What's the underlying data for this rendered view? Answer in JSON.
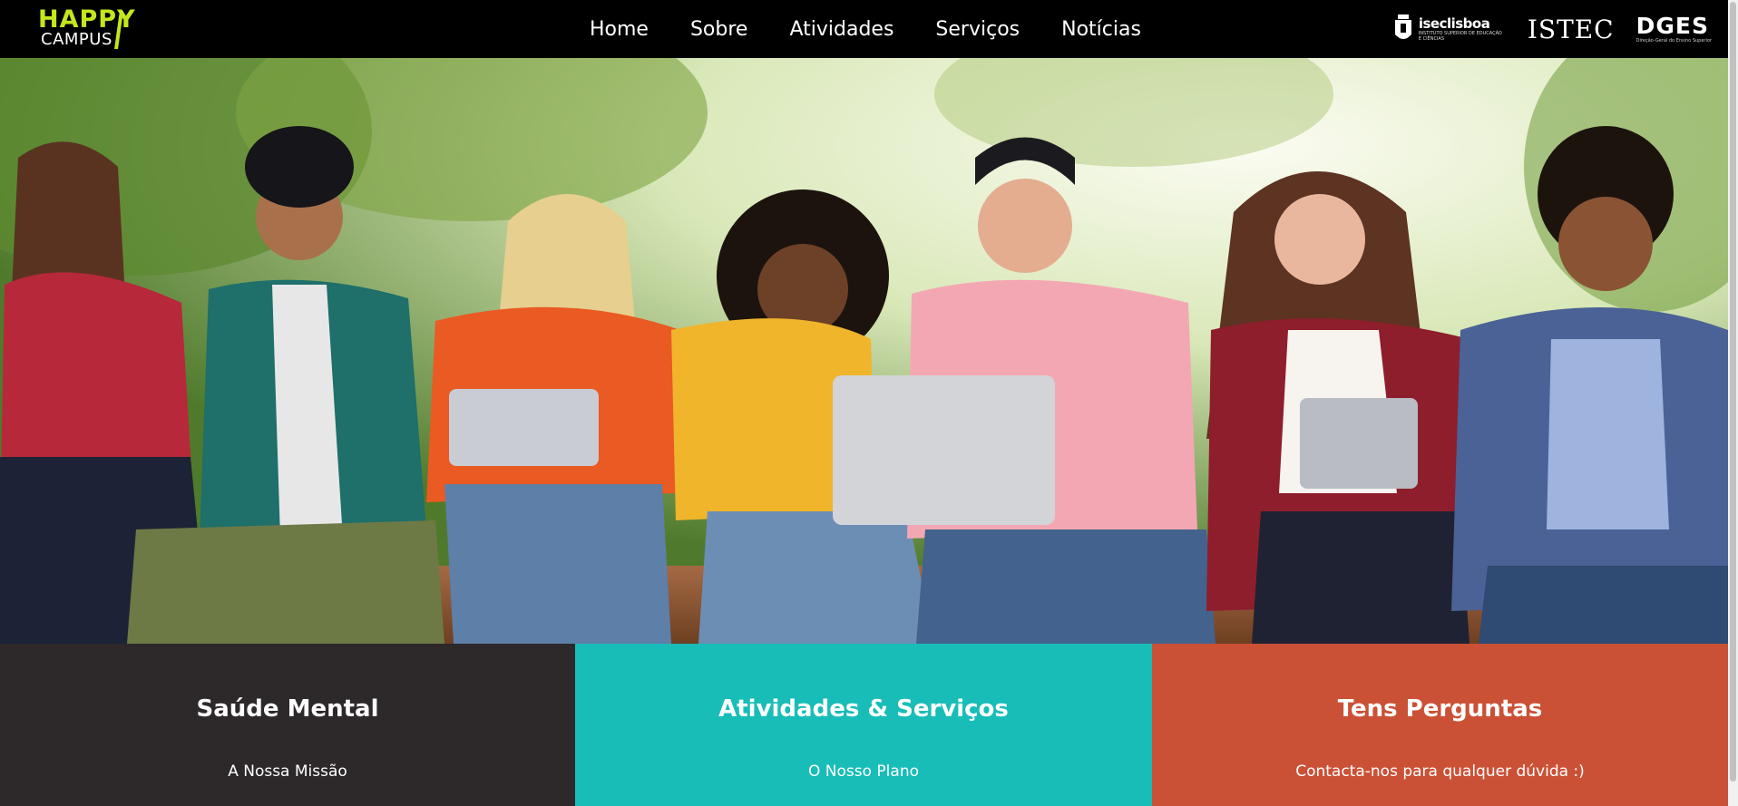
{
  "brand": {
    "line1": "HAPPY",
    "line2": "CAMPUS",
    "accent_color": "#c4e61c"
  },
  "nav": {
    "items": [
      {
        "label": "Home"
      },
      {
        "label": "Sobre"
      },
      {
        "label": "Atividades"
      },
      {
        "label": "Serviços"
      },
      {
        "label": "Notícias"
      }
    ]
  },
  "partners": {
    "isec": {
      "name": "iseclisboa",
      "subtitle": "INSTITUTO SUPERIOR DE EDUCAÇÃO E CIÊNCIAS"
    },
    "istec": {
      "name": "ISTEC"
    },
    "dges": {
      "name": "DGES",
      "subtitle": "Direção-Geral do Ensino Superior"
    }
  },
  "hero": {
    "image": "group-of-students-with-laptops-and-tablets"
  },
  "panels": [
    {
      "title": "Saúde Mental",
      "subtitle": "A Nossa Missão",
      "color": "#2d2829"
    },
    {
      "title": "Atividades & Serviços",
      "subtitle": "O Nosso Plano",
      "color": "#19bdb8"
    },
    {
      "title": "Tens Perguntas",
      "subtitle": "Contacta-nos para qualquer dúvida :)",
      "color": "#cb5136"
    }
  ]
}
